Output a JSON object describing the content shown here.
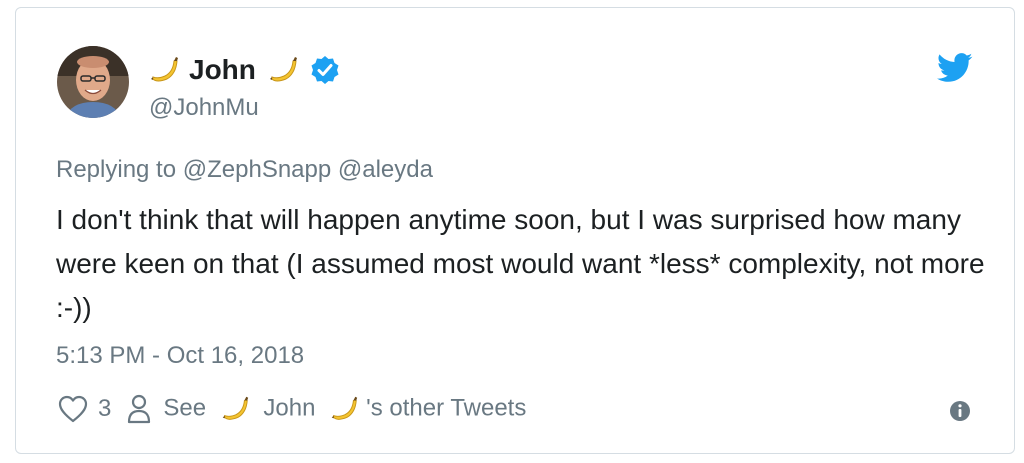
{
  "author": {
    "name": "John",
    "handle": "@JohnMu",
    "name_emoji": "banana-icon"
  },
  "tweet": {
    "replying_prefix": "Replying to",
    "replying_to": [
      "@ZephSnapp",
      "@aleyda"
    ],
    "text": "I don't think that will happen anytime soon, but I was surprised how many were keen on that (I assumed most would want *less* complexity, not more :-))",
    "timestamp": "5:13 PM - Oct 16, 2018"
  },
  "actions": {
    "like_count": "3",
    "see_label": "See",
    "name": "John",
    "other_tweets_suffix": "'s other Tweets"
  },
  "icons": {
    "brand": "twitter-bird-icon",
    "verified": "verified-badge-icon",
    "like": "heart-icon",
    "profile": "person-icon",
    "info": "info-icon"
  },
  "colors": {
    "twitter_blue": "#1da1f2",
    "muted_text": "#697882",
    "body_text": "#1c2022",
    "border": "#d5dde3",
    "banana": "#f4c430"
  }
}
